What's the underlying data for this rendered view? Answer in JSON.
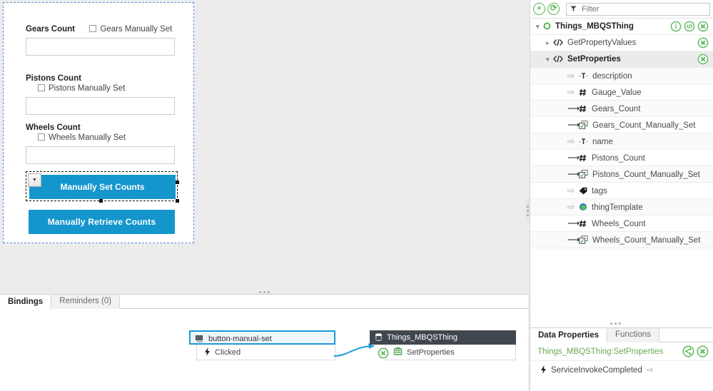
{
  "canvas": {
    "form": {
      "fields": [
        {
          "label": "Gears Count",
          "checkbox_label": "Gears Manually Set",
          "value": "",
          "placeholder": ""
        },
        {
          "label": "Pistons Count",
          "checkbox_label": "Pistons Manually Set",
          "value": "",
          "placeholder": ""
        },
        {
          "label": "Wheels Count",
          "checkbox_label": "Wheels Manually Set",
          "value": "",
          "placeholder": ""
        }
      ],
      "buttons": {
        "set": "Manually Set Counts",
        "retrieve": "Manually Retrieve Counts"
      },
      "accent_color": "#1496cd"
    }
  },
  "bindings_panel": {
    "tabs": [
      {
        "label": "Bindings",
        "active": true
      },
      {
        "label": "Reminders (0)",
        "active": false
      }
    ],
    "source": {
      "title": "button-manual-set",
      "icon": "widget-icon",
      "event": "Clicked",
      "event_icon": "lightning-icon"
    },
    "target": {
      "title": "Things_MBQSThing",
      "icon": "database-icon",
      "service": "SetProperties",
      "service_icon": "service-icon",
      "remove_icon": "remove-circle-icon"
    }
  },
  "right_panel": {
    "toolbar": {
      "add_label": "+",
      "refresh_label": "⟳",
      "filter_placeholder": "Filter",
      "filter_value": ""
    },
    "tree": [
      {
        "label": "Things_MBQSThing",
        "level": 0,
        "icon": "thing-icon",
        "chevron": "down",
        "actions": [
          "info-icon",
          "code-icon",
          "remove-circle-icon"
        ],
        "selected": false
      },
      {
        "label": "GetPropertyValues",
        "level": 1,
        "icon": "code-icon",
        "chevron": "right",
        "actions": [
          "remove-circle-icon"
        ],
        "selected": false
      },
      {
        "label": "SetProperties",
        "level": 1,
        "icon": "code-icon",
        "chevron": "down",
        "actions": [
          "remove-circle-icon"
        ],
        "selected": true
      },
      {
        "label": "description",
        "level": 2,
        "icon": "string-icon",
        "binding": "out"
      },
      {
        "label": "Gauge_Value",
        "level": 2,
        "icon": "number-icon",
        "binding": "out"
      },
      {
        "label": "Gears_Count",
        "level": 2,
        "icon": "number-icon",
        "binding": "in"
      },
      {
        "label": "Gears_Count_Manually_Set",
        "level": 2,
        "icon": "boolean-icon",
        "binding": "in"
      },
      {
        "label": "name",
        "level": 2,
        "icon": "string-icon",
        "binding": "out"
      },
      {
        "label": "Pistons_Count",
        "level": 2,
        "icon": "number-icon",
        "binding": "in"
      },
      {
        "label": "Pistons_Count_Manually_Set",
        "level": 2,
        "icon": "boolean-icon",
        "binding": "in"
      },
      {
        "label": "tags",
        "level": 2,
        "icon": "tag-icon",
        "binding": "out"
      },
      {
        "label": "thingTemplate",
        "level": 2,
        "icon": "template-icon",
        "binding": "out"
      },
      {
        "label": "Wheels_Count",
        "level": 2,
        "icon": "number-icon",
        "binding": "in"
      },
      {
        "label": "Wheels_Count_Manually_Set",
        "level": 2,
        "icon": "boolean-icon",
        "binding": "in"
      }
    ],
    "data_properties": {
      "tabs": [
        {
          "label": "Data Properties",
          "active": true
        },
        {
          "label": "Functions",
          "active": false
        }
      ],
      "service_title": "Things_MBQSThing:SetProperties",
      "service_actions": [
        "share-icon",
        "remove-circle-icon"
      ],
      "events": [
        {
          "label": "ServiceInvokeCompleted",
          "icon": "lightning-icon"
        }
      ]
    }
  },
  "colors": {
    "accent_blue": "#1496cd",
    "green": "#5cb85c",
    "dark_header": "#41474f",
    "select_blue": "#1b9ad6"
  }
}
